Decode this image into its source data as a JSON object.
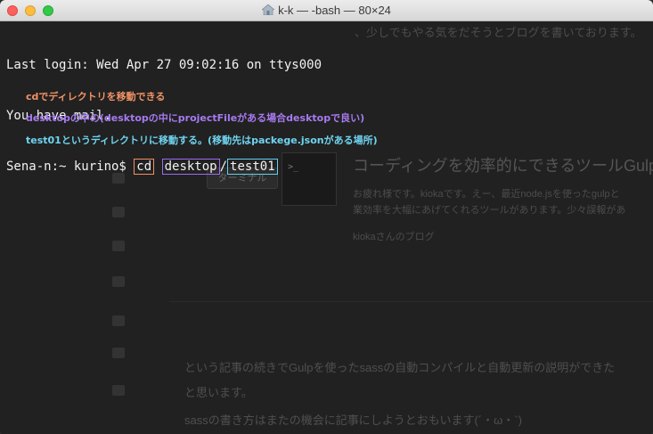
{
  "window": {
    "title": "k-k — -bash — 80×24",
    "icon": "home-folder-icon"
  },
  "terminal": {
    "line1": "Last login: Wed Apr 27 09:02:16 on ttys000",
    "line2": "You have mail.",
    "prompt": "Sena-n:~ kurino$ ",
    "cmd": "cd",
    "arg_dir": "desktop",
    "slash": "/",
    "arg_sub": "test01"
  },
  "annotations": {
    "cd": "cdでディレクトリを移動できる",
    "desktop": "desktopの中の(desktopの中にprojectFileがある場合desktopで良い)",
    "test01": "test01というディレクトリに移動する。(移動先はpackege.jsonがある場所)"
  },
  "colors": {
    "cd": "#f09060",
    "desktop": "#9b6cf0",
    "test01": "#5fd0ee"
  },
  "background_page": {
    "top_text": "、少しでもやる気をだそうとブログを書いております。",
    "button_label": "ターミナル",
    "thumb_prompt": ">_",
    "card_title": "コーディングを効率的にできるツールGulp",
    "card_desc1": "お疲れ様です。kiokaです。えー、最近node.jsを使ったgulpと",
    "card_desc2": "業効率を大幅にあげてくれるツールがあります。少々誤報があ",
    "card_source": "kiokaさんのブログ",
    "para1": "という記事の続きでGulpを使ったsassの自動コンパイルと自動更新の説明ができた",
    "para2": "と思います。",
    "para3": "sassの書き方はまたの機会に記事にしようとおもいます(´・ω・`)"
  }
}
